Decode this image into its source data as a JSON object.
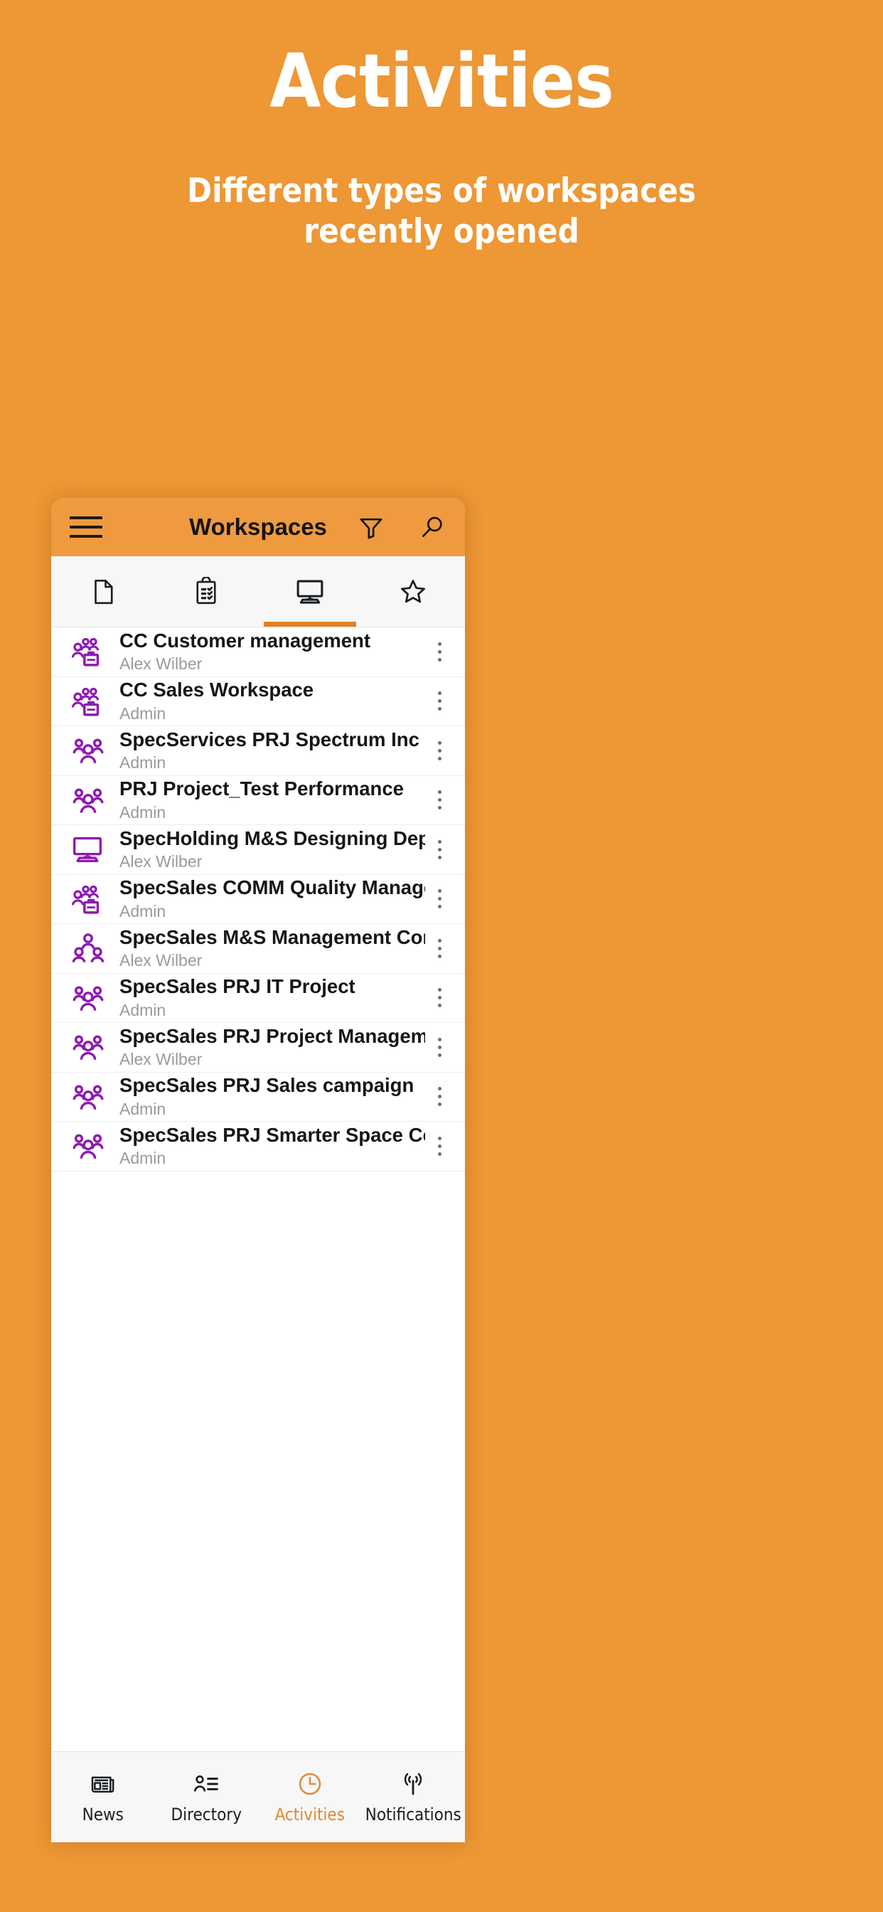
{
  "promo": {
    "title": "Activities",
    "subtitle_line1": "Different types of workspaces",
    "subtitle_line2": "recently opened"
  },
  "colors": {
    "background": "#ed9735",
    "appbar": "#ef9a3e",
    "accent": "#e38128",
    "icon_purple": "#8e1bb0",
    "active_nav": "#e08a2e"
  },
  "appbar": {
    "menu_icon": "hamburger-icon",
    "title": "Workspaces",
    "filter_icon": "filter-icon",
    "search_icon": "search-icon"
  },
  "tabs": [
    {
      "icon": "document-icon",
      "label": "Documents",
      "active": false
    },
    {
      "icon": "clipboard-checklist-icon",
      "label": "Tasks",
      "active": false
    },
    {
      "icon": "monitor-icon",
      "label": "Workspaces",
      "active": true
    },
    {
      "icon": "star-icon",
      "label": "Favorites",
      "active": false
    }
  ],
  "list": {
    "rows": [
      {
        "title": "CC Customer management",
        "subtitle": "Alex Wilber",
        "icon": "group-briefcase-icon"
      },
      {
        "title": "CC Sales Workspace",
        "subtitle": "Admin",
        "icon": "group-briefcase-icon"
      },
      {
        "title": "SpecServices PRJ Spectrum Inc project",
        "subtitle": "Admin",
        "icon": "group-icon"
      },
      {
        "title": "PRJ Project_Test Performance",
        "subtitle": "Admin",
        "icon": "group-icon"
      },
      {
        "title": "SpecHolding M&S Designing Deparment",
        "subtitle": "Alex Wilber",
        "icon": "monitor-icon"
      },
      {
        "title": "SpecSales COMM Quality Management",
        "subtitle": "Admin",
        "icon": "group-briefcase-icon"
      },
      {
        "title": "SpecSales M&S Management Committee",
        "subtitle": "Alex Wilber",
        "icon": "group-triangle-icon"
      },
      {
        "title": "SpecSales PRJ IT Project",
        "subtitle": "Admin",
        "icon": "group-icon"
      },
      {
        "title": "SpecSales PRJ Project Management",
        "subtitle": "Alex Wilber",
        "icon": "group-icon"
      },
      {
        "title": "SpecSales PRJ Sales campaign",
        "subtitle": "Admin",
        "icon": "group-icon"
      },
      {
        "title": "SpecSales PRJ Smarter Space Co",
        "subtitle": "Admin",
        "icon": "group-icon"
      }
    ],
    "more_icon": "more-vertical-icon"
  },
  "bottomnav": [
    {
      "label": "News",
      "icon": "newspaper-icon",
      "active": false
    },
    {
      "label": "Directory",
      "icon": "person-list-icon",
      "active": false
    },
    {
      "label": "Activities",
      "icon": "clock-icon",
      "active": true
    },
    {
      "label": "Notifications",
      "icon": "broadcast-icon",
      "active": false
    }
  ]
}
